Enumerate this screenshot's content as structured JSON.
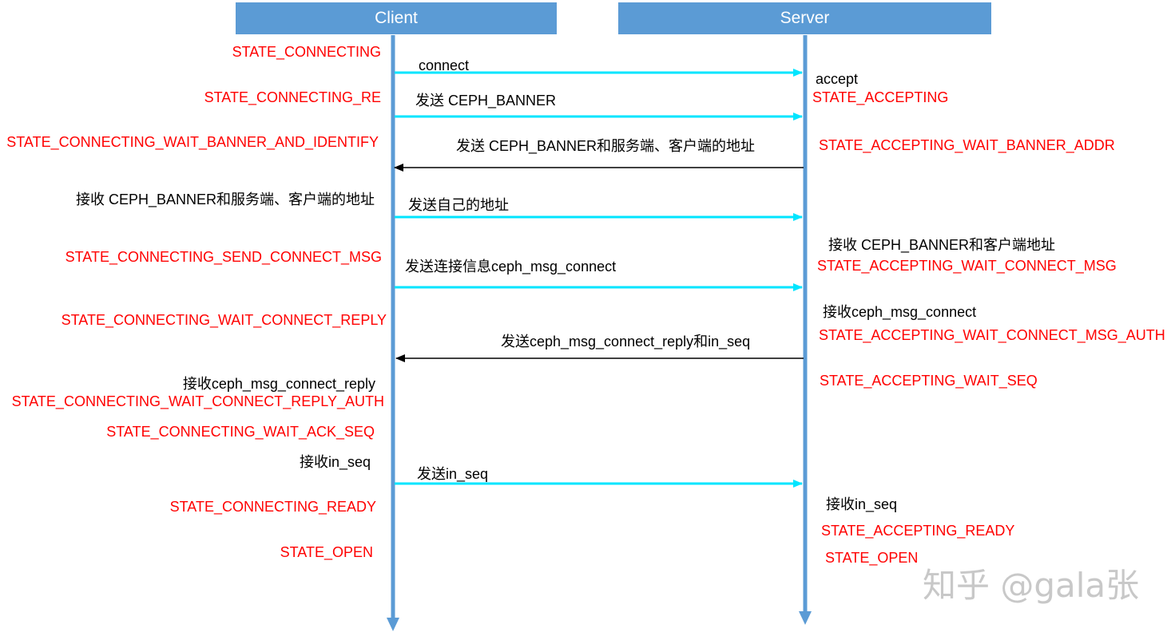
{
  "actors": {
    "client": "Client",
    "server": "Server"
  },
  "client_labels": [
    {
      "id": "c1",
      "kind": "state",
      "text": "STATE_CONNECTING"
    },
    {
      "id": "c2",
      "kind": "state",
      "text": "STATE_CONNECTING_RE"
    },
    {
      "id": "c3",
      "kind": "state",
      "text": "STATE_CONNECTING_WAIT_BANNER_AND_IDENTIFY"
    },
    {
      "id": "c4",
      "kind": "note",
      "text": "接收 CEPH_BANNER和服务端、客户端的地址"
    },
    {
      "id": "c5",
      "kind": "state",
      "text": "STATE_CONNECTING_SEND_CONNECT_MSG"
    },
    {
      "id": "c6",
      "kind": "state",
      "text": "STATE_CONNECTING_WAIT_CONNECT_REPLY"
    },
    {
      "id": "c7",
      "kind": "note",
      "text": "接收ceph_msg_connect_reply"
    },
    {
      "id": "c8",
      "kind": "state",
      "text": "STATE_CONNECTING_WAIT_CONNECT_REPLY_AUTH"
    },
    {
      "id": "c9",
      "kind": "state",
      "text": "STATE_CONNECTING_WAIT_ACK_SEQ"
    },
    {
      "id": "c10",
      "kind": "note",
      "text": "接收in_seq"
    },
    {
      "id": "c11",
      "kind": "state",
      "text": "STATE_CONNECTING_READY"
    },
    {
      "id": "c12",
      "kind": "state",
      "text": "STATE_OPEN"
    }
  ],
  "server_labels": [
    {
      "id": "s1",
      "kind": "note",
      "text": "accept"
    },
    {
      "id": "s2",
      "kind": "state",
      "text": "STATE_ACCEPTING"
    },
    {
      "id": "s3",
      "kind": "state",
      "text": "STATE_ACCEPTING_WAIT_BANNER_ADDR"
    },
    {
      "id": "s4",
      "kind": "note",
      "text": "接收 CEPH_BANNER和客户端地址"
    },
    {
      "id": "s5",
      "kind": "state",
      "text": "STATE_ACCEPTING_WAIT_CONNECT_MSG"
    },
    {
      "id": "s6",
      "kind": "note",
      "text": "接收ceph_msg_connect"
    },
    {
      "id": "s7",
      "kind": "state",
      "text": "STATE_ACCEPTING_WAIT_CONNECT_MSG_AUTH"
    },
    {
      "id": "s8",
      "kind": "state",
      "text": "STATE_ACCEPTING_WAIT_SEQ"
    },
    {
      "id": "s9",
      "kind": "note",
      "text": "接收in_seq"
    },
    {
      "id": "s10",
      "kind": "state",
      "text": "STATE_ACCEPTING_READY"
    },
    {
      "id": "s11",
      "kind": "state",
      "text": "STATE_OPEN"
    }
  ],
  "messages": [
    {
      "id": "m1",
      "direction": "client-to-server",
      "label": "connect"
    },
    {
      "id": "m2",
      "direction": "client-to-server",
      "label": "发送 CEPH_BANNER"
    },
    {
      "id": "m3",
      "direction": "server-to-client",
      "label": "发送 CEPH_BANNER和服务端、客户端的地址"
    },
    {
      "id": "m4",
      "direction": "client-to-server",
      "label": "发送自己的地址"
    },
    {
      "id": "m5",
      "direction": "client-to-server",
      "label": "发送连接信息ceph_msg_connect"
    },
    {
      "id": "m6",
      "direction": "server-to-client",
      "label": "发送ceph_msg_connect_reply和in_seq"
    },
    {
      "id": "m7",
      "direction": "client-to-server",
      "label": "发送in_seq"
    }
  ],
  "watermark": "知乎 @gala张",
  "colors": {
    "actor_fill": "#5b9bd5",
    "lifeline": "#5b9bd5",
    "client_to_server_arrow": "#00ffff",
    "server_to_client_arrow": "#000000",
    "state_text": "#ff0000",
    "note_text": "#000000"
  }
}
